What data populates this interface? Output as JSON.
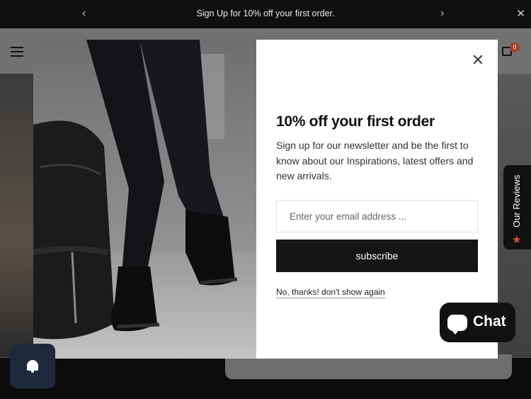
{
  "announcement": {
    "text": "Sign Up for 10% off your first order.",
    "prev_icon": "chevron-left-icon",
    "next_icon": "chevron-right-icon",
    "close_icon": "close-icon"
  },
  "header": {
    "menu_icon": "hamburger-menu-icon",
    "cart_icon": "shopping-bag-icon",
    "cart_count": "0"
  },
  "popup": {
    "title": "10% off your first order",
    "description": "Sign up for our newsletter and be the first to know about our Inspirations, latest offers and new arrivals.",
    "email_placeholder": "Enter your email address ...",
    "subscribe_label": "subscribe",
    "decline_label": "No, thanks! don't show again",
    "close_icon": "close-icon",
    "image": "person-in-black-boots-with-leather-bag-photo"
  },
  "reviews_tab": {
    "label": "Our Reviews",
    "icon": "star-icon"
  },
  "chat_widget": {
    "label": "Chat",
    "icon": "chat-bubble-icon"
  },
  "notification_button": {
    "icon": "bell-icon"
  },
  "colors": {
    "announcement_bg": "#0f0f0f",
    "button_bg": "#151515",
    "cart_badge": "#a0412b",
    "review_star": "#d45a2a",
    "bell_bg": "#1d2a3b"
  }
}
